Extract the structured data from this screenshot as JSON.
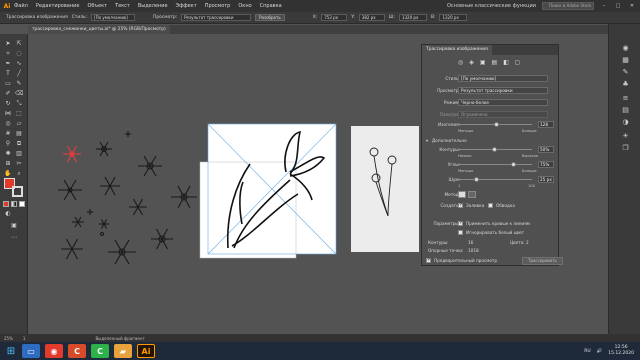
{
  "app": {
    "logo": "Ai"
  },
  "menu": [
    "Файл",
    "Редактирование",
    "Объект",
    "Текст",
    "Выделение",
    "Эффект",
    "Просмотр",
    "Окно",
    "Справка"
  ],
  "workspace_label": "Основные классические функции",
  "search_placeholder": "Поиск в Adobe Stock",
  "control": {
    "tool_label": "Трассировка изображения",
    "styles_label": "Стиль:",
    "style_value": "[По умолчанию]",
    "preset_label": "Просмотр:",
    "preset_value": "Результат трассировки",
    "expand_button": "Разобрать",
    "x": "753 px",
    "y": "382 px",
    "w": "1320 px",
    "h": "1320 px"
  },
  "document_tab": "трассировка_снежинки_цветы.ai* @ 25% (RGB/Просмотр)",
  "panel": {
    "title": "Трассировка изображения",
    "preset_label": "Стиль:",
    "preset_value": "[По умолчанию]",
    "view_label": "Просмотр:",
    "view_value": "Результат трассировки",
    "mode_label": "Режим:",
    "mode_value": "Черно-белое",
    "palette_label": "Палитра:",
    "palette_value": "Ограничено",
    "threshold_label": "Изогелия:",
    "threshold_value": "128",
    "less_label": "Меньше",
    "more_label": "Больше",
    "advanced_label": "Дополнительно",
    "paths_label": "Контуры:",
    "paths_value": "50%",
    "low_label": "Низкое",
    "high_label": "Высокое",
    "corners_label": "Углы:",
    "corners_value": "75%",
    "noise_label": "Шум:",
    "noise_value": "25 px",
    "noise_min": "1",
    "noise_max": "100",
    "method_label": "Метод:",
    "create_label": "Создать:",
    "fill_label": "Заливка",
    "stroke_label": "Обводка",
    "options_label": "Параметры:",
    "snap_label": "Применить кривые к линиям",
    "ignore_white_label": "Игнорировать белый цвет",
    "paths_count_label": "Контуры:",
    "paths_count": "16",
    "colors_label": "Цвета:",
    "colors_count": "2",
    "anchors_label": "Опорные точки:",
    "anchors_count": "1018",
    "preview_label": "Предварительный просмотр",
    "trace_button": "Трассировать"
  },
  "status": {
    "zoom": "25%",
    "page": "1",
    "selection": "Выделенный фрагмент"
  },
  "taskbar": {
    "lang": "RU",
    "time": "12:56",
    "date": "15.12.2020"
  },
  "colors": {
    "app_bg": "#535353",
    "accent_orange": "#ff9a00",
    "fill_swatch": "#e03a2a",
    "snowflake_red": "#e83c3c"
  },
  "icons": [
    "selection-tool-icon",
    "direct-selection-icon",
    "pen-tool-icon",
    "type-tool-icon",
    "brush-icon",
    "eraser-icon",
    "rotate-icon",
    "scale-icon",
    "gradient-icon",
    "eyedropper-icon",
    "zoom-icon",
    "hand-icon"
  ]
}
